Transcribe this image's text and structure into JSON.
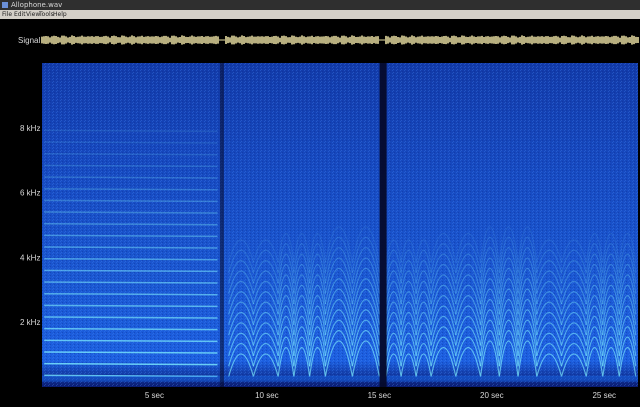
{
  "window": {
    "title": "Allophone.wav",
    "icon": "waveform-app-icon"
  },
  "menu": {
    "items": [
      "File",
      "Edit",
      "View",
      "Tools",
      "Help"
    ]
  },
  "signal": {
    "label": "Signal"
  },
  "chart_data": {
    "type": "heatmap",
    "title": "",
    "xlabel": "",
    "ylabel": "",
    "x_ticks": [
      {
        "value": 5,
        "label": "5 sec"
      },
      {
        "value": 10,
        "label": "10 sec"
      },
      {
        "value": 15,
        "label": "15 sec"
      },
      {
        "value": 20,
        "label": "20 sec"
      },
      {
        "value": 25,
        "label": "25 sec"
      }
    ],
    "y_ticks": [
      {
        "value": 2,
        "label": "2 kHz"
      },
      {
        "value": 4,
        "label": "4 kHz"
      },
      {
        "value": 6,
        "label": "6 kHz"
      },
      {
        "value": 8,
        "label": "8 kHz"
      }
    ],
    "xlim": [
      0,
      26.5
    ],
    "ylim": [
      0,
      10
    ],
    "colors": {
      "background": "#000000",
      "low": "#0b2ea8",
      "mid": "#1a6cf0",
      "high": "#7ff0ff",
      "signal": "#fff4b2"
    },
    "silence_gaps_sec": [
      8.0,
      15.1
    ]
  }
}
